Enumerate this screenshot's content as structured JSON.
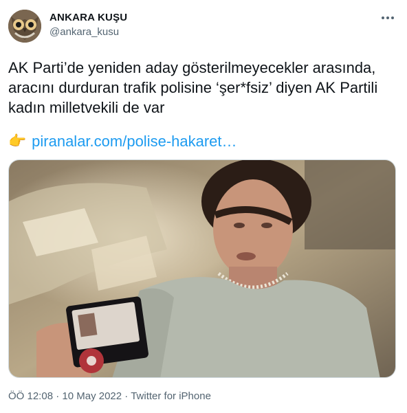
{
  "author": {
    "name": "ANKARA KUŞU",
    "handle": "@ankara_kusu"
  },
  "tweet": {
    "text": "AK Parti’de yeniden aday gösterilmeyecekler arasında, aracını durduran trafik polisine ‘şer*fsiz’ diyen AK Partili kadın milletvekili de var",
    "link_emoji": "👉",
    "link_text": "piranalar.com/polise-hakaret…"
  },
  "icons": {
    "more": "more-dots-icon",
    "avatar": "owl-avatar"
  },
  "meta": {
    "time": "ÖÖ 12:08",
    "date": "10 May 2022",
    "source": "Twitter for iPhone",
    "separator": "·"
  },
  "colors": {
    "link": "#1d9bf0",
    "secondary_text": "#536471",
    "primary_text": "#0f1419"
  }
}
